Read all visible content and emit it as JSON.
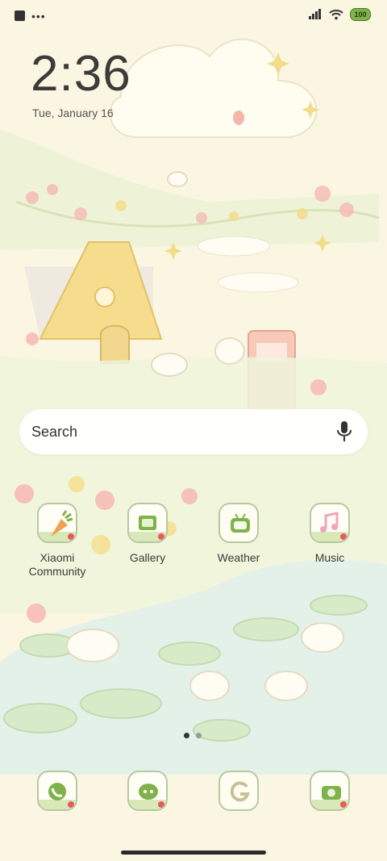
{
  "status_bar": {
    "battery": "100"
  },
  "lock": {
    "time": "2:36",
    "date": "Tue, January 16"
  },
  "search": {
    "label": "Search"
  },
  "apps": [
    {
      "label": "Xiaomi\nCommunity",
      "icon": "carrot-icon"
    },
    {
      "label": "Gallery",
      "icon": "gallery-icon"
    },
    {
      "label": "Weather",
      "icon": "weather-tv-icon"
    },
    {
      "label": "Music",
      "icon": "music-note-icon"
    }
  ],
  "dock": [
    {
      "icon": "phone-icon"
    },
    {
      "icon": "messages-icon"
    },
    {
      "icon": "google-icon"
    },
    {
      "icon": "camera-icon"
    }
  ],
  "colors": {
    "background": "#fbf6e2",
    "icon_border": "#b8c9a0",
    "accent_green": "#7fb24a"
  }
}
